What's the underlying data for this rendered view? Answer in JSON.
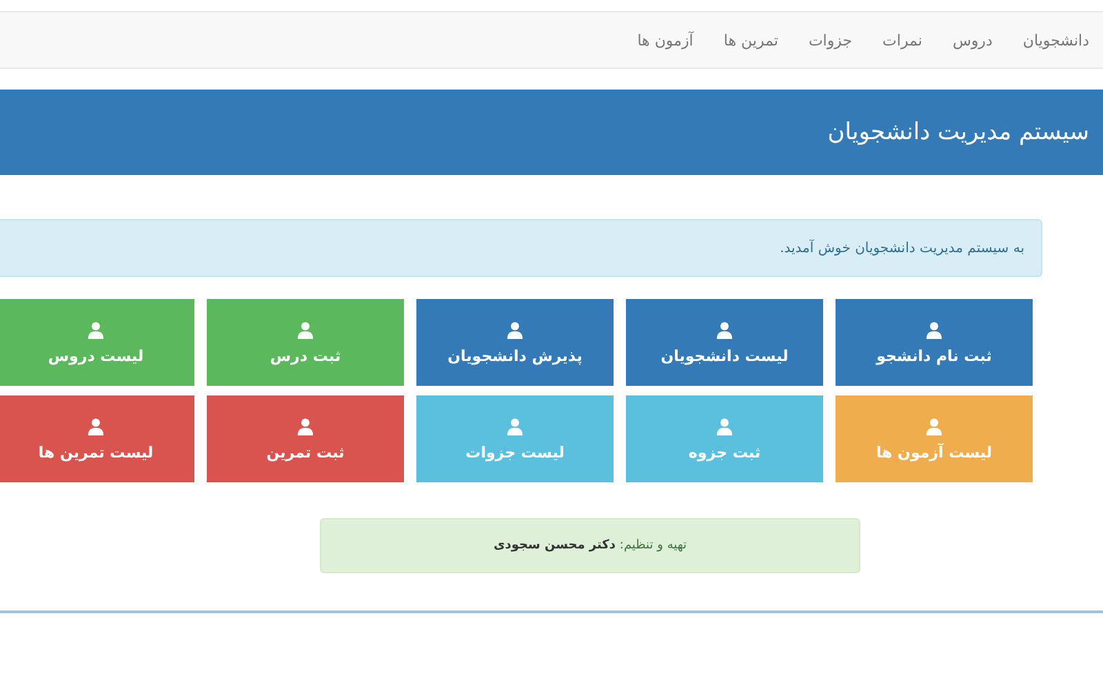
{
  "nav": {
    "items": [
      {
        "label": "دانشجویان"
      },
      {
        "label": "دروس"
      },
      {
        "label": "نمرات"
      },
      {
        "label": "جزوات"
      },
      {
        "label": "تمرین ها"
      },
      {
        "label": "آزمون ها"
      }
    ]
  },
  "header": {
    "title": "سیستم مدیریت دانشجویان"
  },
  "alert": {
    "text": "به سیستم مدیریت دانشجویان خوش آمدید."
  },
  "tiles": [
    {
      "label": "ثبت نام دانشجو",
      "color": "#337ab7"
    },
    {
      "label": "لیست دانشجویان",
      "color": "#337ab7"
    },
    {
      "label": "پذیرش دانشجویان",
      "color": "#337ab7"
    },
    {
      "label": "ثبت درس",
      "color": "#5cb85c"
    },
    {
      "label": "لیست دروس",
      "color": "#5cb85c"
    },
    {
      "label": "لیست آزمون ها",
      "color": "#f0ad4e"
    },
    {
      "label": "ثبت جزوه",
      "color": "#5bc0de"
    },
    {
      "label": "لیست جزوات",
      "color": "#5bc0de"
    },
    {
      "label": "ثبت تمرین",
      "color": "#d9534f"
    },
    {
      "label": "لیست تمرین ها",
      "color": "#d9534f"
    }
  ],
  "footer": {
    "text": "تهیه و تنظیم: **دکتر محسن سجودی**"
  }
}
